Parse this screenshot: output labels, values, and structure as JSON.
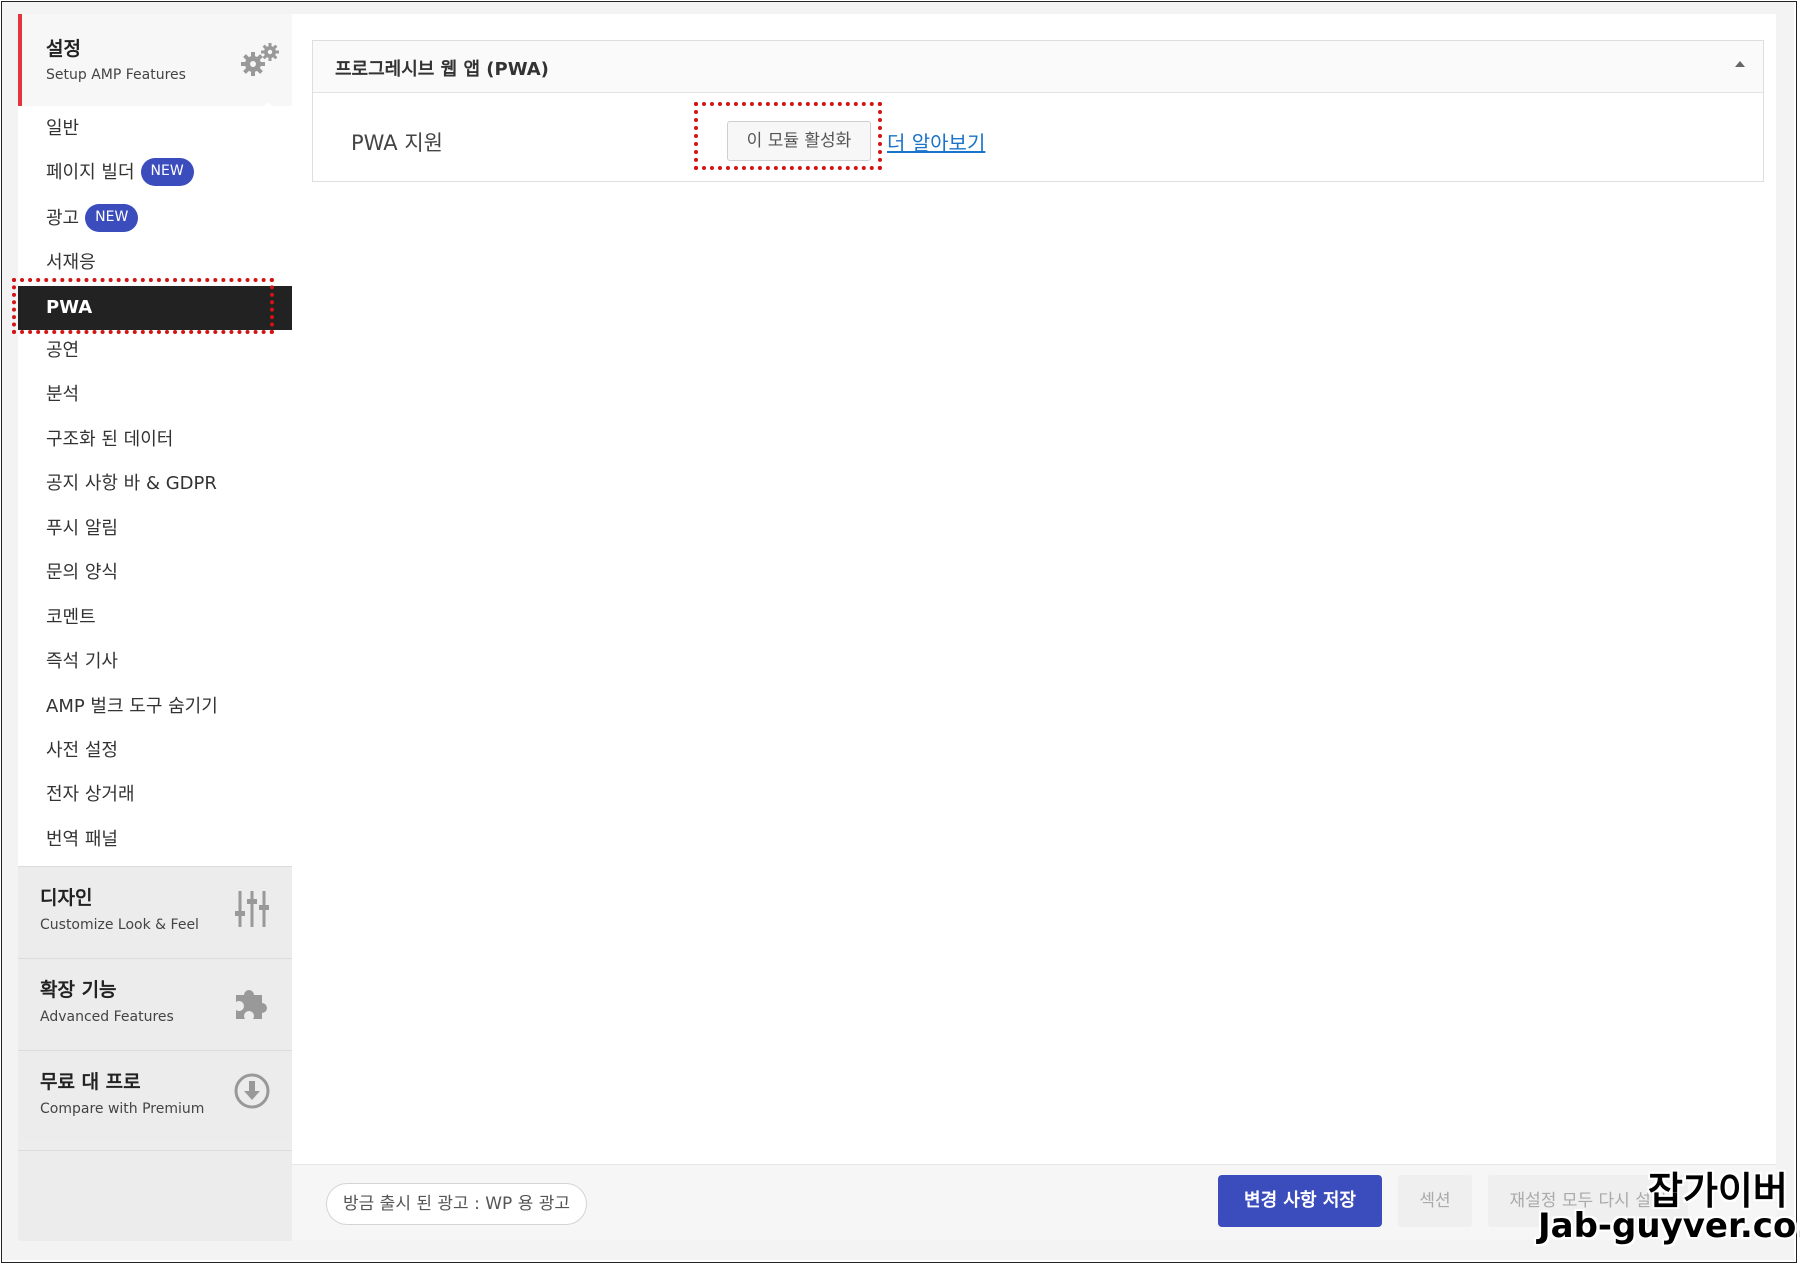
{
  "sidebar": {
    "setup": {
      "title": "설정",
      "subtitle": "Setup AMP Features",
      "icon": "gears-icon"
    },
    "items": [
      {
        "label": "일반"
      },
      {
        "label": "페이지 빌더",
        "badge": "NEW"
      },
      {
        "label": "광고",
        "badge": "NEW"
      },
      {
        "label": "서재응"
      },
      {
        "label": "PWA",
        "active": true
      },
      {
        "label": "공연"
      },
      {
        "label": "분석"
      },
      {
        "label": "구조화 된 데이터"
      },
      {
        "label": "공지 사항 바 & GDPR"
      },
      {
        "label": "푸시 알림"
      },
      {
        "label": "문의 양식"
      },
      {
        "label": "코멘트"
      },
      {
        "label": "즉석 기사"
      },
      {
        "label": "AMP 벌크 도구 숨기기"
      },
      {
        "label": "사전 설정"
      },
      {
        "label": "전자 상거래"
      },
      {
        "label": "번역 패널"
      }
    ],
    "sections": [
      {
        "title": "디자인",
        "subtitle": "Customize Look & Feel",
        "icon": "sliders-icon"
      },
      {
        "title": "확장 기능",
        "subtitle": "Advanced Features",
        "icon": "puzzle-icon"
      },
      {
        "title": "무료 대 프로",
        "subtitle": "Compare with Premium",
        "icon": "download-circle-icon"
      }
    ]
  },
  "main": {
    "panel_title": "프로그레시브 웹 앱 (PWA)",
    "pwa_label": "PWA 지원",
    "activate_button": "이 모듈 활성화",
    "learn_more": "더 알아보기"
  },
  "footer": {
    "news": "방금 출시 된 광고 : WP 용 광고",
    "save": "변경 사항 저장",
    "section": "섹션",
    "reset": "재설정 모두 다시 설정"
  },
  "watermark": {
    "line1": "잡가이버",
    "line2": "Jab-guyver.co.kr"
  },
  "colors": {
    "accent": "#3b4dbd",
    "active_bg": "#222222",
    "highlight": "#d31414",
    "setup_border": "#e1343b",
    "link": "#1a74c9"
  }
}
